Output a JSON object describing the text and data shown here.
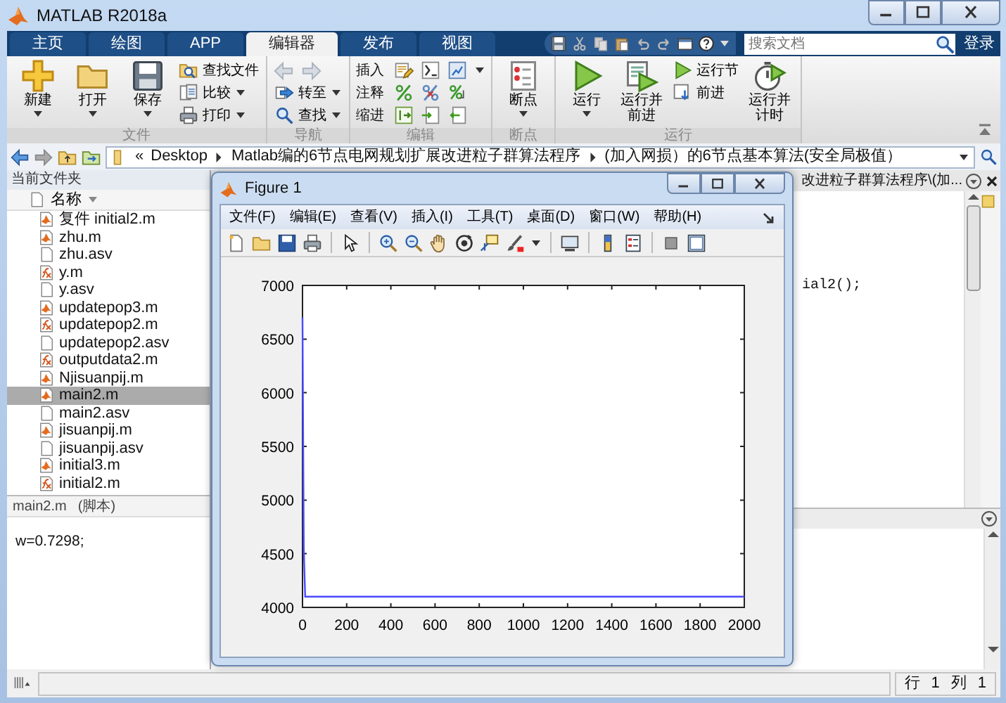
{
  "window": {
    "title": "MATLAB R2018a"
  },
  "tabs": [
    {
      "label": "主页",
      "selected": false
    },
    {
      "label": "绘图",
      "selected": false
    },
    {
      "label": "APP",
      "selected": false
    },
    {
      "label": "编辑器",
      "selected": true
    },
    {
      "label": "发布",
      "selected": false
    },
    {
      "label": "视图",
      "selected": false
    }
  ],
  "search": {
    "placeholder": "搜索文档"
  },
  "login_button": "登录",
  "ribbon": [
    {
      "label": "文件",
      "items": [
        {
          "kind": "large",
          "label": "新建",
          "dropdown": true
        },
        {
          "kind": "large",
          "label": "打开",
          "dropdown": true
        },
        {
          "kind": "large",
          "label": "保存",
          "dropdown": true
        },
        {
          "kind": "small",
          "label": "查找文件",
          "dropdown": false
        },
        {
          "kind": "small",
          "label": "比较",
          "dropdown": true
        },
        {
          "kind": "small",
          "label": "打印",
          "dropdown": true
        }
      ]
    },
    {
      "label": "导航",
      "items": [
        {
          "kind": "arrows",
          "disabled": true
        },
        {
          "kind": "small",
          "label": "转至",
          "dropdown": true
        },
        {
          "kind": "small",
          "label": "查找",
          "dropdown": true
        }
      ]
    },
    {
      "label": "编辑",
      "items": [
        {
          "kind": "icons",
          "label": "插入",
          "dropdown": true
        },
        {
          "kind": "icons",
          "label": "注释",
          "dropdown": false
        },
        {
          "kind": "icons",
          "label": "缩进",
          "dropdown": false
        }
      ]
    },
    {
      "label": "断点",
      "items": [
        {
          "kind": "large",
          "label": "断点",
          "dropdown": true
        }
      ]
    },
    {
      "label": "运行",
      "items": [
        {
          "kind": "large",
          "label": "运行",
          "dropdown": true
        },
        {
          "kind": "large",
          "label": "运行并前进",
          "dropdown": false
        },
        {
          "kind": "small",
          "label": "运行节",
          "dropdown": false
        },
        {
          "kind": "small",
          "label": "前进",
          "dropdown": false
        },
        {
          "kind": "large",
          "label": "运行并计时",
          "dropdown": false
        }
      ]
    }
  ],
  "address": {
    "overflow": "«",
    "segments": [
      "Desktop",
      "Matlab编的6节点电网规划扩展改进粒子群算法程序",
      "(加入网损）的6节点基本算法(安全局极值）"
    ]
  },
  "current_folder": {
    "title": "当前文件夹",
    "column": "名称",
    "files": [
      {
        "name": "复件 initial2.m",
        "kind": "script",
        "selected": false
      },
      {
        "name": "zhu.m",
        "kind": "script",
        "selected": false
      },
      {
        "name": "zhu.asv",
        "kind": "text",
        "selected": false
      },
      {
        "name": "y.m",
        "kind": "function",
        "selected": false
      },
      {
        "name": "y.asv",
        "kind": "text",
        "selected": false
      },
      {
        "name": "updatepop3.m",
        "kind": "script",
        "selected": false
      },
      {
        "name": "updatepop2.m",
        "kind": "function",
        "selected": false
      },
      {
        "name": "updatepop2.asv",
        "kind": "text",
        "selected": false
      },
      {
        "name": "outputdata2.m",
        "kind": "function",
        "selected": false
      },
      {
        "name": "Njisuanpij.m",
        "kind": "script",
        "selected": false
      },
      {
        "name": "main2.m",
        "kind": "script",
        "selected": true
      },
      {
        "name": "main2.asv",
        "kind": "text",
        "selected": false
      },
      {
        "name": "jisuanpij.m",
        "kind": "script",
        "selected": false
      },
      {
        "name": "jisuanpij.asv",
        "kind": "text",
        "selected": false
      },
      {
        "name": "initial3.m",
        "kind": "script",
        "selected": false
      },
      {
        "name": "initial2.m",
        "kind": "function",
        "selected": false
      }
    ]
  },
  "details": {
    "file": "main2.m",
    "type": "(脚本)",
    "preview": "w=0.7298;"
  },
  "editor": {
    "tab_title": "改进粒子群算法程序\\(加...",
    "code": "ial2();"
  },
  "figure": {
    "title": "Figure 1",
    "menus": [
      "文件(F)",
      "编辑(E)",
      "查看(V)",
      "插入(I)",
      "工具(T)",
      "桌面(D)",
      "窗口(W)",
      "帮助(H)"
    ],
    "chart_data": {
      "type": "line",
      "x": [
        0,
        6,
        12,
        2000
      ],
      "series": [
        {
          "color": "#4a4aff",
          "values": [
            6700,
            4550,
            4100,
            4100
          ]
        }
      ],
      "xlim": [
        0,
        2000
      ],
      "ylim": [
        4000,
        7000
      ],
      "xticks": [
        0,
        200,
        400,
        600,
        800,
        1000,
        1200,
        1400,
        1600,
        1800,
        2000
      ],
      "yticks": [
        4000,
        4500,
        5000,
        5500,
        6000,
        6500,
        7000
      ]
    }
  },
  "status_bar": [
    {
      "label": "行",
      "value": "1"
    },
    {
      "label": "列",
      "value": "1"
    }
  ]
}
